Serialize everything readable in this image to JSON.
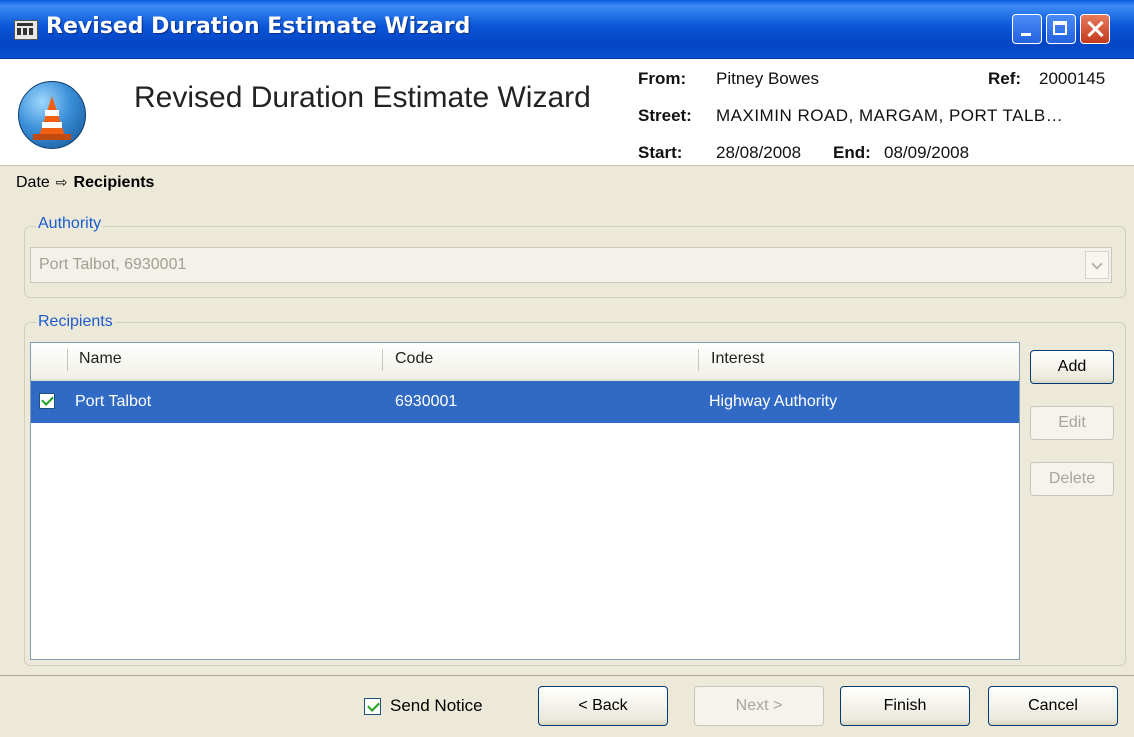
{
  "window": {
    "title": "Revised Duration Estimate Wizard"
  },
  "header": {
    "title": "Revised Duration Estimate Wizard",
    "from_label": "From:",
    "from_value": "Pitney Bowes",
    "ref_label": "Ref:",
    "ref_value": "2000145",
    "street_label": "Street:",
    "street_value": "MAXIMIN ROAD, MARGAM, PORT TALB…",
    "start_label": "Start:",
    "start_value": "28/08/2008",
    "end_label": "End:",
    "end_value": "08/09/2008"
  },
  "breadcrumb": {
    "step1": "Date",
    "arrow": "⇨",
    "current": "Recipients"
  },
  "authority": {
    "legend": "Authority",
    "value": "Port Talbot, 6930001"
  },
  "recipients": {
    "legend": "Recipients",
    "columns": [
      "Name",
      "Code",
      "Interest"
    ],
    "rows": [
      {
        "checked": true,
        "name": "Port Talbot",
        "code": "6930001",
        "interest": "Highway Authority"
      }
    ],
    "buttons": {
      "add": "Add",
      "edit": "Edit",
      "delete": "Delete"
    }
  },
  "footer": {
    "send_notice": "Send Notice",
    "back": "< Back",
    "next": "Next >",
    "finish": "Finish",
    "cancel": "Cancel"
  },
  "icons": {
    "app": "app-icon",
    "logo": "traffic-cone-icon",
    "check": "checkmark-icon"
  },
  "colors": {
    "titlebar": "#0a56d8",
    "selection": "#316ac5",
    "legend": "#1c5ad0"
  }
}
